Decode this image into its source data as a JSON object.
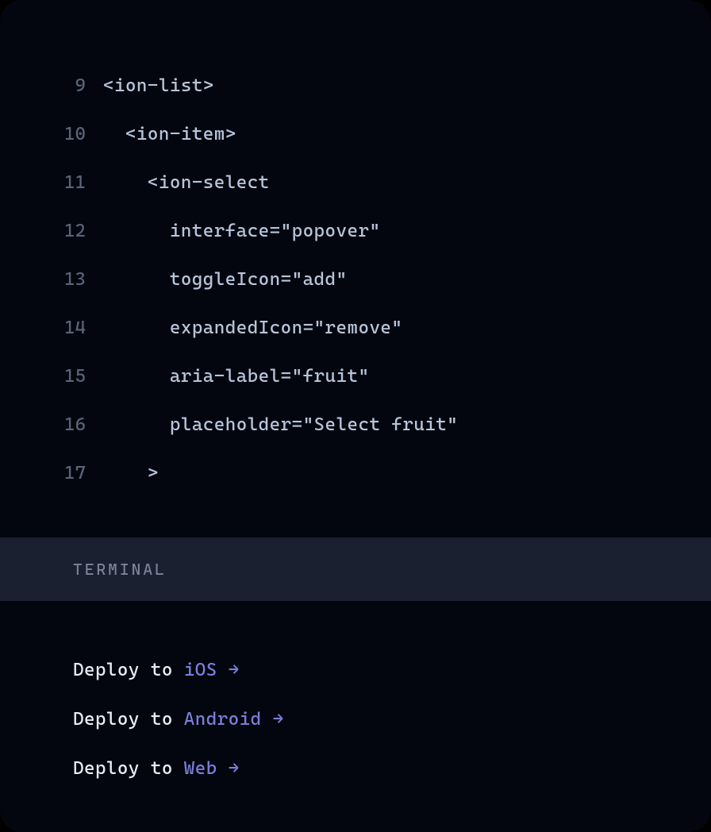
{
  "code": {
    "lines": [
      {
        "num": "9",
        "text": "<ion-list>"
      },
      {
        "num": "10",
        "text": "  <ion-item>"
      },
      {
        "num": "11",
        "text": "    <ion-select"
      },
      {
        "num": "12",
        "text": "      interface=\"popover\""
      },
      {
        "num": "13",
        "text": "      toggleIcon=\"add\""
      },
      {
        "num": "14",
        "text": "      expandedIcon=\"remove\""
      },
      {
        "num": "15",
        "text": "      aria-label=\"fruit\""
      },
      {
        "num": "16",
        "text": "      placeholder=\"Select fruit\""
      },
      {
        "num": "17",
        "text": "    >"
      }
    ]
  },
  "terminal": {
    "header": "TERMINAL",
    "lines": [
      {
        "prefix": "Deploy to ",
        "target": "iOS",
        "suffix": " →"
      },
      {
        "prefix": "Deploy to ",
        "target": "Android",
        "suffix": " →"
      },
      {
        "prefix": "Deploy to ",
        "target": "Web",
        "suffix": " →"
      }
    ]
  }
}
